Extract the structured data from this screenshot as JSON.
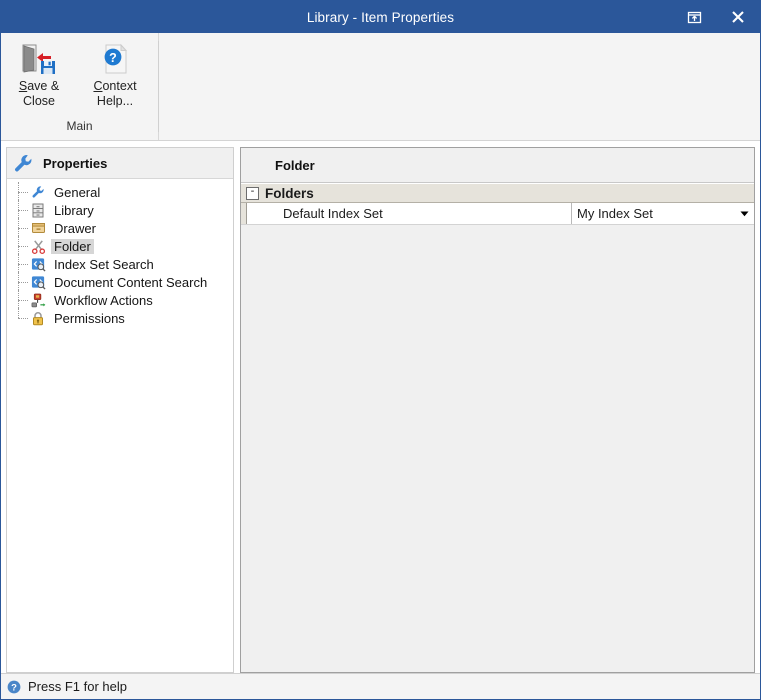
{
  "window": {
    "title": "Library - Item Properties",
    "titlebar_buttons": [
      {
        "name": "restore-window",
        "icon": "restore-icon",
        "label": ""
      },
      {
        "name": "close-window",
        "icon": "close-icon",
        "label": ""
      }
    ],
    "accent_color": "#2b579a"
  },
  "ribbon": {
    "groups": [
      {
        "label": "Main",
        "buttons": [
          {
            "label_line1": "Save &",
            "label_line2": "Close",
            "accesskey": "S",
            "icon": "save-and-close-icon"
          },
          {
            "label_line1": "Context",
            "label_line2": "Help...",
            "accesskey": "C",
            "icon": "context-help-icon"
          }
        ]
      }
    ]
  },
  "sidebar": {
    "header": {
      "title": "Properties",
      "icon": "wrench-icon"
    },
    "items": [
      {
        "label": "General",
        "icon": "wrench-icon",
        "selected": false
      },
      {
        "label": "Library",
        "icon": "cabinet-icon",
        "selected": false
      },
      {
        "label": "Drawer",
        "icon": "drawer-icon",
        "selected": false
      },
      {
        "label": "Folder",
        "icon": "scissors-icon",
        "selected": true
      },
      {
        "label": "Index Set Search",
        "icon": "code-search-icon",
        "selected": false
      },
      {
        "label": "Document Content Search",
        "icon": "code-search-icon",
        "selected": false
      },
      {
        "label": "Workflow Actions",
        "icon": "workflow-icon",
        "selected": false
      },
      {
        "label": "Permissions",
        "icon": "lock-icon",
        "selected": false
      }
    ]
  },
  "content": {
    "header_title": "Folder",
    "property_grid": {
      "groups": [
        {
          "label": "Folders",
          "expander": "-",
          "expanded": true,
          "rows": [
            {
              "name": "Default Index Set",
              "value": "My Index Set",
              "editor": "dropdown"
            }
          ]
        }
      ]
    }
  },
  "statusbar": {
    "icon": "help-circle-icon",
    "text": "Press F1 for help"
  }
}
